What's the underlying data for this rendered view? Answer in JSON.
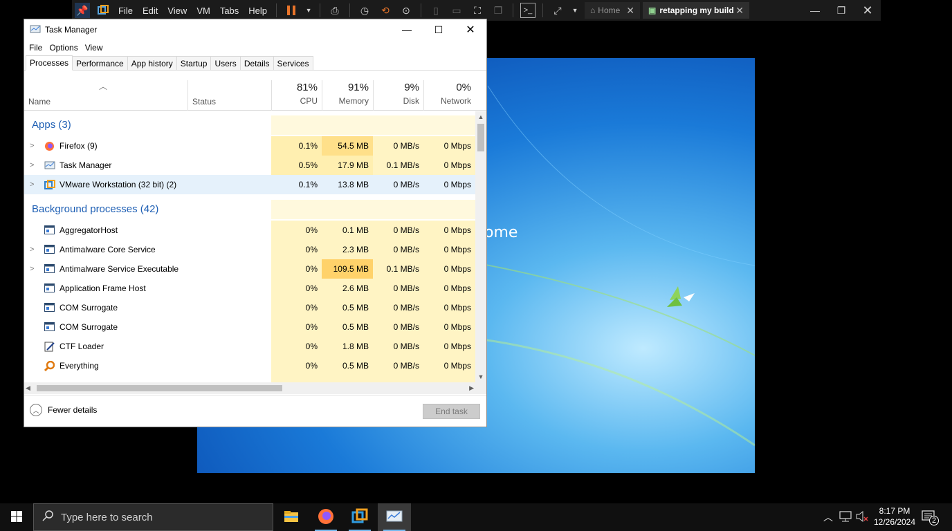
{
  "vmware": {
    "menu": [
      "File",
      "Edit",
      "View",
      "VM",
      "Tabs",
      "Help"
    ],
    "tabs": [
      {
        "label": "Home",
        "active": false
      },
      {
        "label": "retapping my build",
        "active": true
      }
    ]
  },
  "guest": {
    "welcome_partial": "ome"
  },
  "task_manager": {
    "title": "Task Manager",
    "menu": [
      "File",
      "Options",
      "View"
    ],
    "tabs": [
      "Processes",
      "Performance",
      "App history",
      "Startup",
      "Users",
      "Details",
      "Services"
    ],
    "selected_tab": "Processes",
    "columns": {
      "name": "Name",
      "status": "Status",
      "cpu": {
        "pct": "81%",
        "label": "CPU"
      },
      "memory": {
        "pct": "91%",
        "label": "Memory"
      },
      "disk": {
        "pct": "9%",
        "label": "Disk"
      },
      "network": {
        "pct": "0%",
        "label": "Network"
      }
    },
    "groups": [
      {
        "title": "Apps (3)",
        "rows": [
          {
            "name": "Firefox (9)",
            "icon": "firefox-icon",
            "expandable": true,
            "cpu": "0.1%",
            "memory": "54.5 MB",
            "disk": "0 MB/s",
            "network": "0 Mbps"
          },
          {
            "name": "Task Manager",
            "icon": "task-manager-icon",
            "expandable": true,
            "cpu": "0.5%",
            "memory": "17.9 MB",
            "disk": "0.1 MB/s",
            "network": "0 Mbps"
          },
          {
            "name": "VMware Workstation (32 bit) (2)",
            "icon": "vmware-icon",
            "expandable": true,
            "selected": true,
            "cpu": "0.1%",
            "memory": "13.8 MB",
            "disk": "0 MB/s",
            "network": "0 Mbps"
          }
        ]
      },
      {
        "title": "Background processes (42)",
        "rows": [
          {
            "name": "AggregatorHost",
            "icon": "process-icon",
            "expandable": false,
            "cpu": "0%",
            "memory": "0.1 MB",
            "disk": "0 MB/s",
            "network": "0 Mbps"
          },
          {
            "name": "Antimalware Core Service",
            "icon": "process-icon",
            "expandable": true,
            "cpu": "0%",
            "memory": "2.3 MB",
            "disk": "0 MB/s",
            "network": "0 Mbps"
          },
          {
            "name": "Antimalware Service Executable",
            "icon": "process-icon",
            "expandable": true,
            "cpu": "0%",
            "memory": "109.5 MB",
            "disk": "0.1 MB/s",
            "network": "0 Mbps"
          },
          {
            "name": "Application Frame Host",
            "icon": "process-icon",
            "expandable": false,
            "cpu": "0%",
            "memory": "2.6 MB",
            "disk": "0 MB/s",
            "network": "0 Mbps"
          },
          {
            "name": "COM Surrogate",
            "icon": "process-icon",
            "expandable": false,
            "cpu": "0%",
            "memory": "0.5 MB",
            "disk": "0 MB/s",
            "network": "0 Mbps"
          },
          {
            "name": "COM Surrogate",
            "icon": "process-icon",
            "expandable": false,
            "cpu": "0%",
            "memory": "0.5 MB",
            "disk": "0 MB/s",
            "network": "0 Mbps"
          },
          {
            "name": "CTF Loader",
            "icon": "ctf-loader-icon",
            "expandable": false,
            "cpu": "0%",
            "memory": "1.8 MB",
            "disk": "0 MB/s",
            "network": "0 Mbps"
          },
          {
            "name": "Everything",
            "icon": "everything-icon",
            "expandable": false,
            "cpu": "0%",
            "memory": "0.5 MB",
            "disk": "0 MB/s",
            "network": "0 Mbps"
          }
        ]
      }
    ],
    "footer": {
      "fewer_details": "Fewer details",
      "end_task": "End task"
    }
  },
  "taskbar": {
    "search_placeholder": "Type here to search",
    "apps": [
      "file-explorer-icon",
      "firefox-icon",
      "vmware-icon",
      "task-manager-icon"
    ],
    "clock_time": "8:17 PM",
    "clock_date": "12/26/2024",
    "notification_count": "2"
  }
}
